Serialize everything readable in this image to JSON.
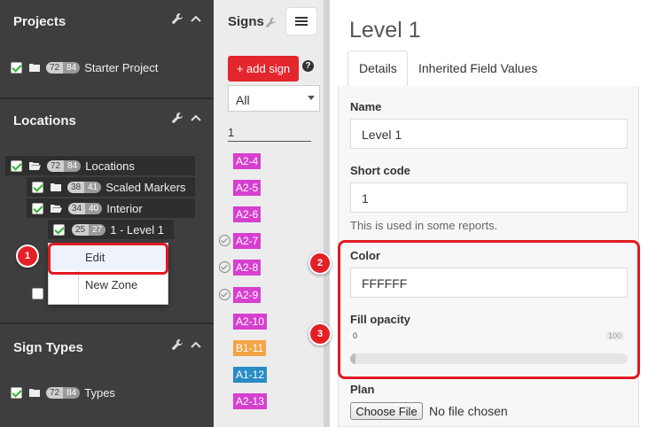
{
  "sidebar": {
    "projects": {
      "title": "Projects",
      "items": [
        {
          "label": "Starter Project",
          "count_a": "72",
          "count_b": "84"
        }
      ]
    },
    "locations": {
      "title": "Locations",
      "items": [
        {
          "label": "Locations",
          "count_a": "72",
          "count_b": "84"
        },
        {
          "label": "Scaled Markers",
          "count_a": "38",
          "count_b": "41"
        },
        {
          "label": "Interior",
          "count_a": "34",
          "count_b": "40"
        },
        {
          "label": "1 - Level 1",
          "count_a": "25",
          "count_b": "27"
        }
      ],
      "context_menu": [
        "Edit",
        "New Zone"
      ]
    },
    "sign_types": {
      "title": "Sign Types",
      "items": [
        {
          "label": "Types",
          "count_a": "72",
          "count_b": "84"
        }
      ]
    }
  },
  "callouts": [
    "1",
    "2",
    "3"
  ],
  "signs": {
    "title": "Signs",
    "add_label": "+ add sign",
    "help": "?",
    "filter_select": "All",
    "filter_text": "1",
    "items": [
      {
        "code": "A2-4",
        "color": "#d63fcf",
        "checked": false
      },
      {
        "code": "A2-5",
        "color": "#d63fcf",
        "checked": false
      },
      {
        "code": "A2-6",
        "color": "#d63fcf",
        "checked": false
      },
      {
        "code": "A2-7",
        "color": "#d63fcf",
        "checked": true
      },
      {
        "code": "A2-8",
        "color": "#d63fcf",
        "checked": true
      },
      {
        "code": "A2-9",
        "color": "#d63fcf",
        "checked": true
      },
      {
        "code": "A2-10",
        "color": "#d63fcf",
        "checked": false
      },
      {
        "code": "B1-11",
        "color": "#f4a347",
        "checked": false
      },
      {
        "code": "A1-12",
        "color": "#2a8cc4",
        "checked": false
      },
      {
        "code": "A2-13",
        "color": "#d63fcf",
        "checked": false
      }
    ]
  },
  "detail": {
    "title": "Level 1",
    "tabs": [
      "Details",
      "Inherited Field Values"
    ],
    "name_label": "Name",
    "name_value": "Level 1",
    "short_code_label": "Short code",
    "short_code_value": "1",
    "short_code_help": "This is used in some reports.",
    "color_label": "Color",
    "color_value": "FFFFFF",
    "fill_opacity_label": "Fill opacity",
    "fill_opacity_min": "0",
    "fill_opacity_max": "100",
    "fill_opacity_value": 0,
    "plan_label": "Plan",
    "choose_file_label": "Choose File",
    "file_status": "No file chosen"
  },
  "colors": {
    "accent_red": "#e4262d",
    "sidebar_bg": "#3e3e3e",
    "check_green": "#2db52d"
  }
}
